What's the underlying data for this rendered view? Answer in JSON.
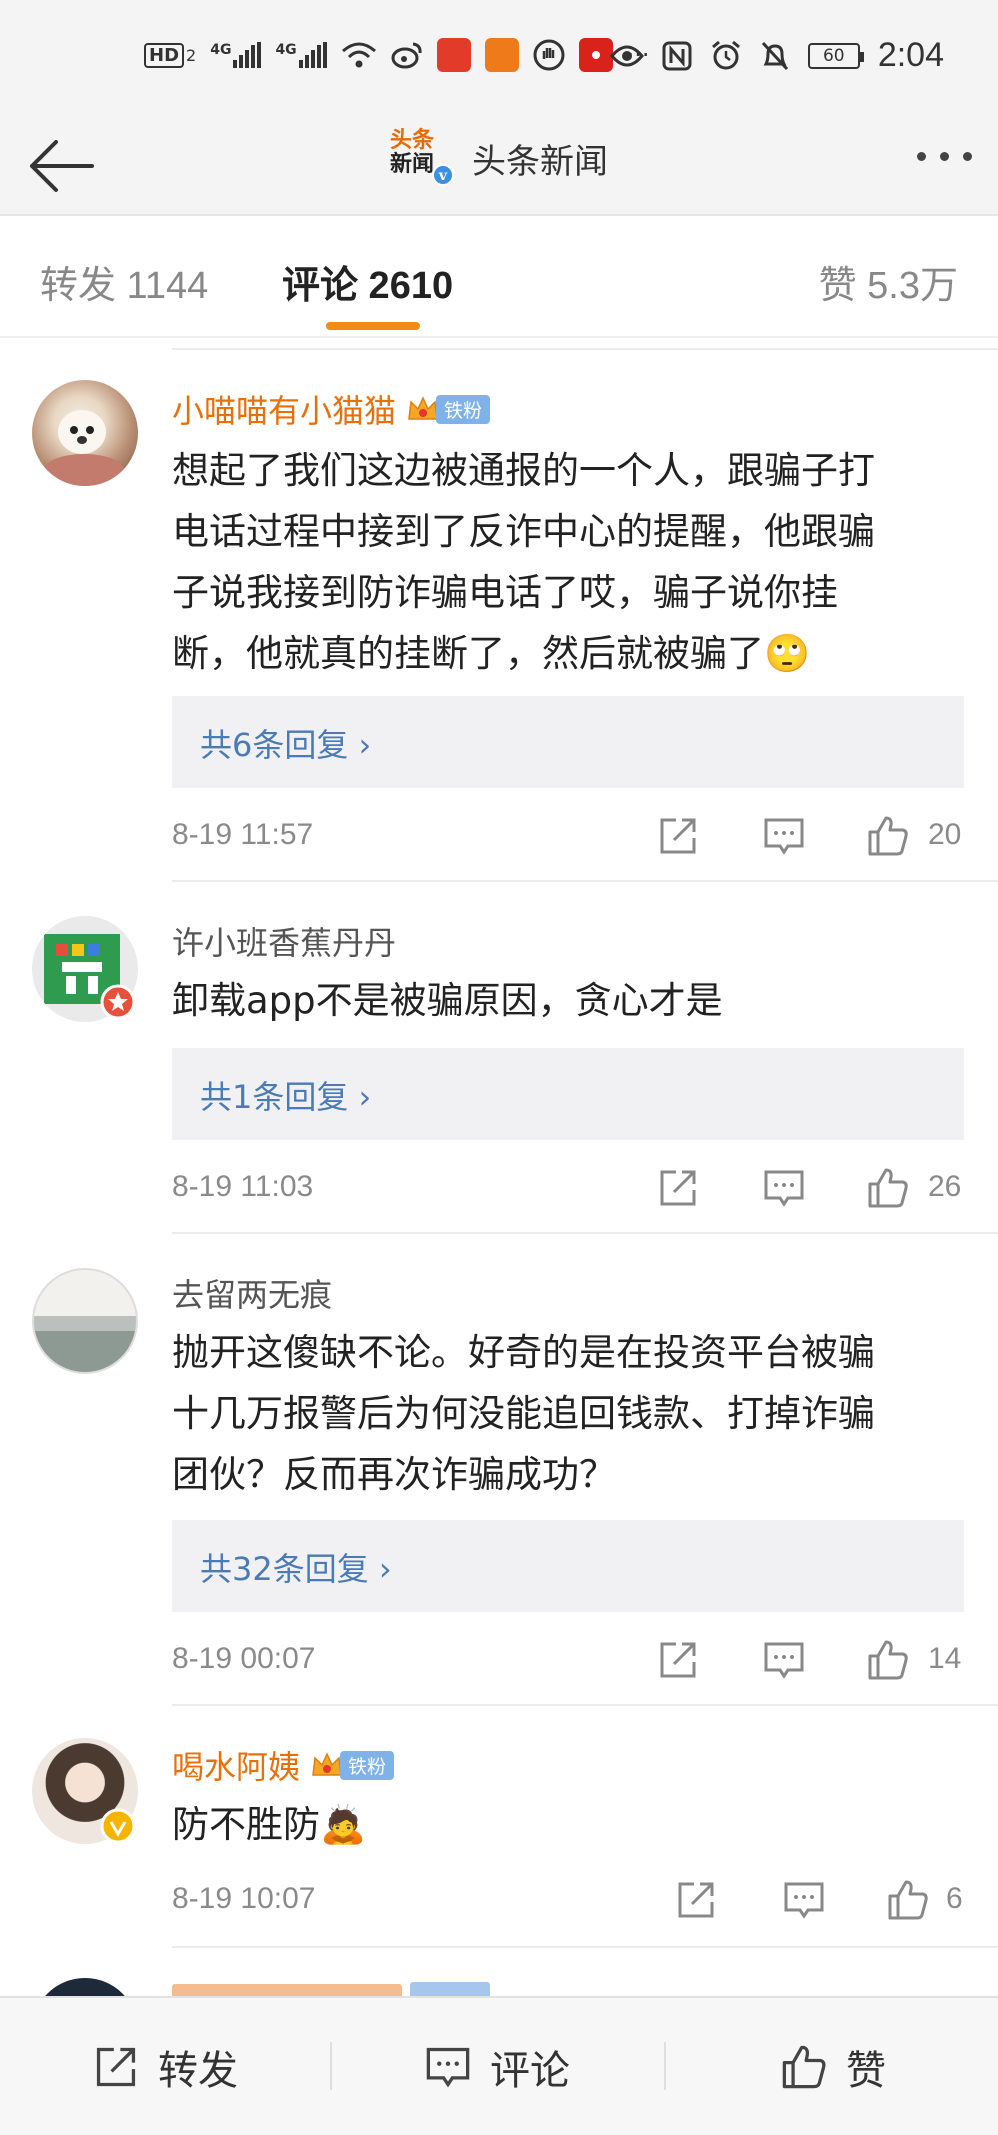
{
  "status_bar": {
    "network_label": "HD",
    "network_sub": "2",
    "signal1": "4G",
    "signal2": "4G",
    "more": "···",
    "battery": "60",
    "time": "2:04"
  },
  "nav": {
    "logo_line1": "头条",
    "logo_line2": "新闻",
    "verified_mark": "v",
    "title": "头条新闻"
  },
  "tabs": {
    "repost": "转发 1144",
    "comments": "评论 2610",
    "likes": "赞 5.3万"
  },
  "comments": [
    {
      "name": "小喵喵有小猫猫",
      "badge": "铁粉",
      "text_lines": [
        "想起了我们这边被通报的一个人，跟骗子打",
        "电话过程中接到了反诈中心的提醒，他跟骗",
        "子说我接到防诈骗电话了哎，骗子说你挂",
        "断，他就真的挂断了，然后就被骗了🙄"
      ],
      "replies": "共6条回复 ›",
      "time": "8-19 11:57",
      "likes": "20"
    },
    {
      "name": "许小班香蕉丹丹",
      "text_lines": [
        "卸载app不是被骗原因，贪心才是"
      ],
      "replies": "共1条回复 ›",
      "time": "8-19 11:03",
      "likes": "26"
    },
    {
      "name": "去留两无痕",
      "text_lines": [
        "抛开这傻缺不论。好奇的是在投资平台被骗",
        "十几万报警后为何没能追回钱款、打掉诈骗",
        "团伙？反而再次诈骗成功？"
      ],
      "replies": "共32条回复 ›",
      "time": "8-19 00:07",
      "likes": "14"
    },
    {
      "name": "喝水阿姨",
      "badge": "铁粉",
      "text_lines": [
        "防不胜防🙇"
      ],
      "time": "8-19 10:07",
      "likes": "6"
    }
  ],
  "bottom_bar": {
    "repost": "转发",
    "comment": "评论",
    "like": "赞"
  },
  "colors": {
    "accent": "#f28c16",
    "name_orange": "#e8700a",
    "link_blue": "#4a7bb7",
    "reply_bg": "#f1f1f3"
  }
}
